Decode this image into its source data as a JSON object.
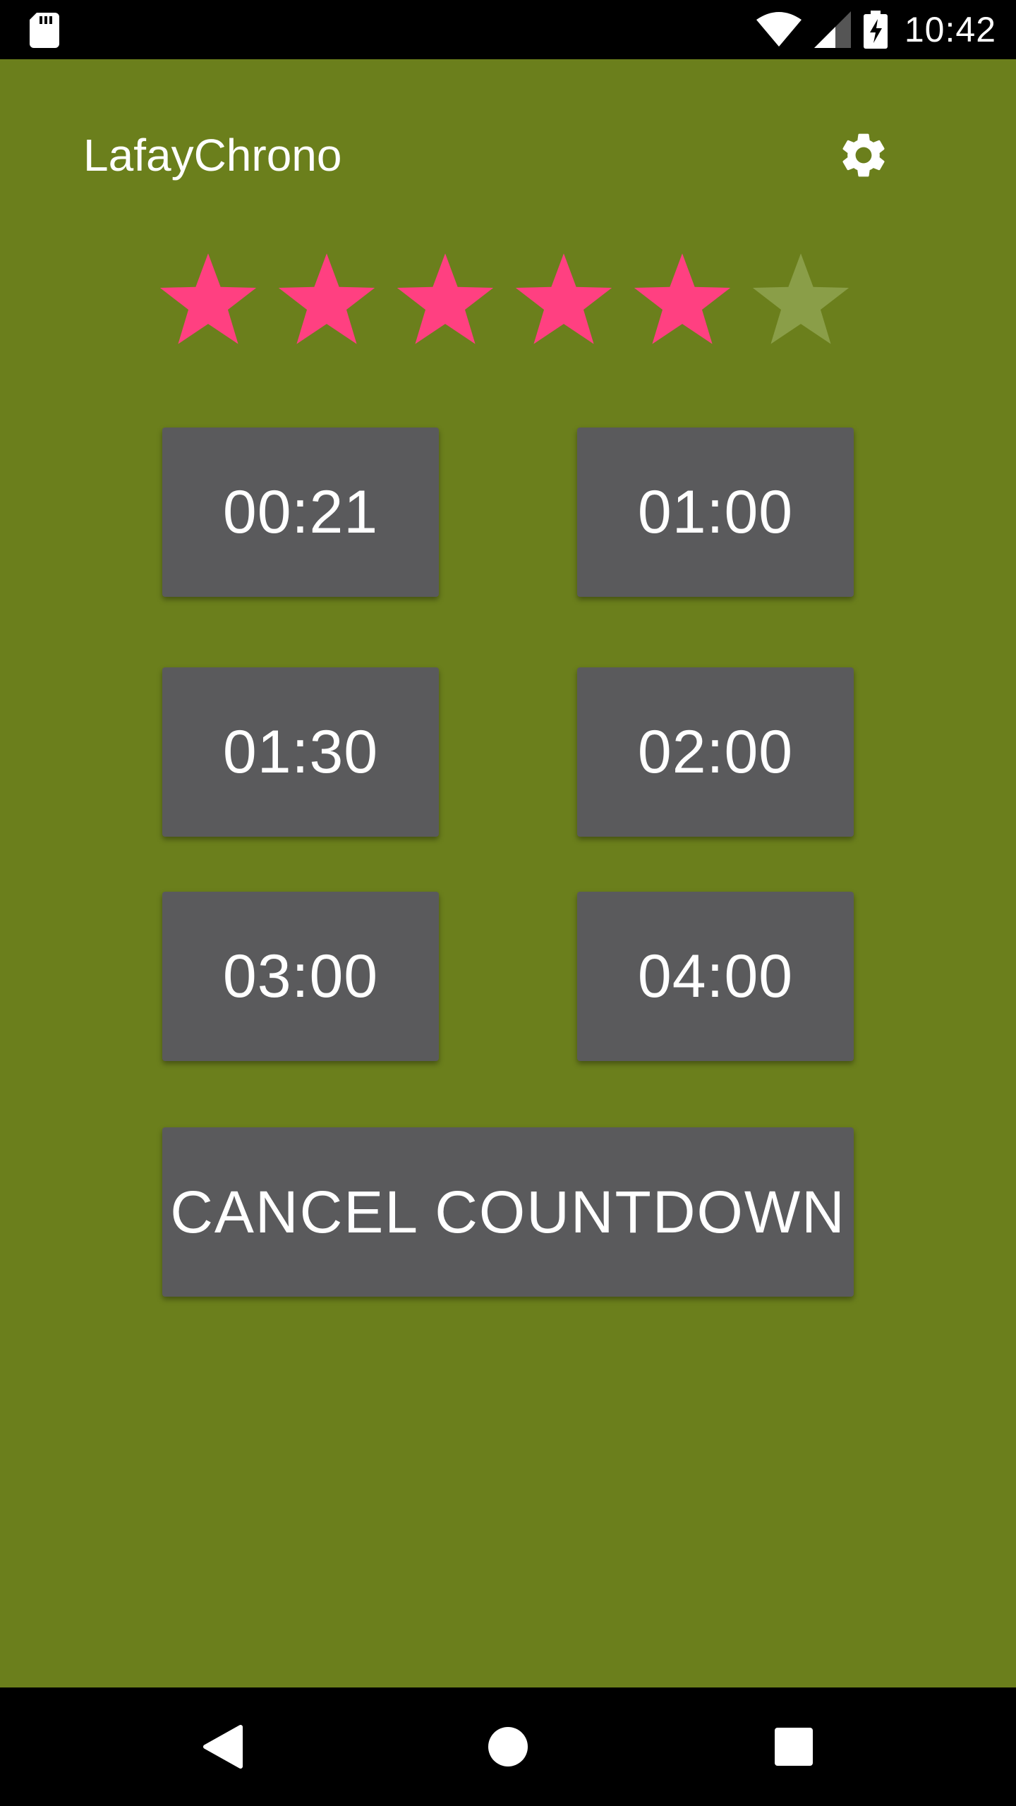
{
  "status_bar": {
    "time": "10:42",
    "icons": [
      "sd-card-icon",
      "wifi-icon",
      "signal-icon",
      "battery-charging-icon"
    ]
  },
  "app": {
    "title": "LafayChrono",
    "settings_icon": "gear-icon"
  },
  "rating": {
    "value": 5,
    "max": 6,
    "filled_color": "#ff4081",
    "empty_color": "#8a9e48"
  },
  "buttons": {
    "timers": [
      "00:21",
      "01:00",
      "01:30",
      "02:00",
      "03:00",
      "04:00"
    ],
    "cancel": "CANCEL COUNTDOWN"
  },
  "nav_bar": {
    "icons": [
      "back-icon",
      "home-icon",
      "recents-icon"
    ]
  },
  "colors": {
    "background": "#6b7f1c",
    "button": "#5a5a5c"
  }
}
